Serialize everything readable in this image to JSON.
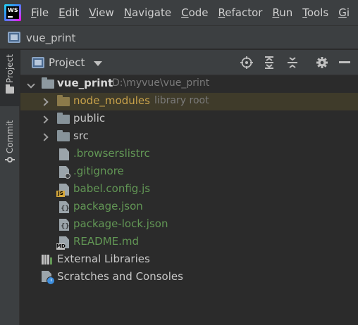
{
  "app": {
    "logo_text": "WS"
  },
  "menu": [
    {
      "label": "File"
    },
    {
      "label": "Edit"
    },
    {
      "label": "View"
    },
    {
      "label": "Navigate"
    },
    {
      "label": "Code"
    },
    {
      "label": "Refactor"
    },
    {
      "label": "Run"
    },
    {
      "label": "Tools"
    },
    {
      "label": "Gi"
    }
  ],
  "breadcrumb": {
    "label": "vue_print"
  },
  "tool_strip": {
    "project_tab": "Project",
    "commit_tab": "Commit"
  },
  "panel": {
    "view_label": "Project"
  },
  "tree": {
    "root": {
      "name": "vue_print",
      "path": "D:\\myvue\\vue_print"
    },
    "items": [
      {
        "name": "node_modules",
        "meta": "library root"
      },
      {
        "name": "public"
      },
      {
        "name": "src"
      },
      {
        "name": ".browserslistrc"
      },
      {
        "name": ".gitignore"
      },
      {
        "name": "babel.config.js",
        "badge": "JS"
      },
      {
        "name": "package.json",
        "badge": "{}"
      },
      {
        "name": "package-lock.json",
        "badge": "{}"
      },
      {
        "name": "README.md",
        "badge": "MD"
      }
    ],
    "external_libraries": "External Libraries",
    "scratches": "Scratches and Consoles"
  },
  "colors": {
    "background": "#2b2b2b",
    "chrome": "#3c3f41",
    "selected_row": "#3f3b2a",
    "vcs_added": "#629755",
    "excluded": "#c9a24a",
    "muted": "#7a7a7a"
  }
}
